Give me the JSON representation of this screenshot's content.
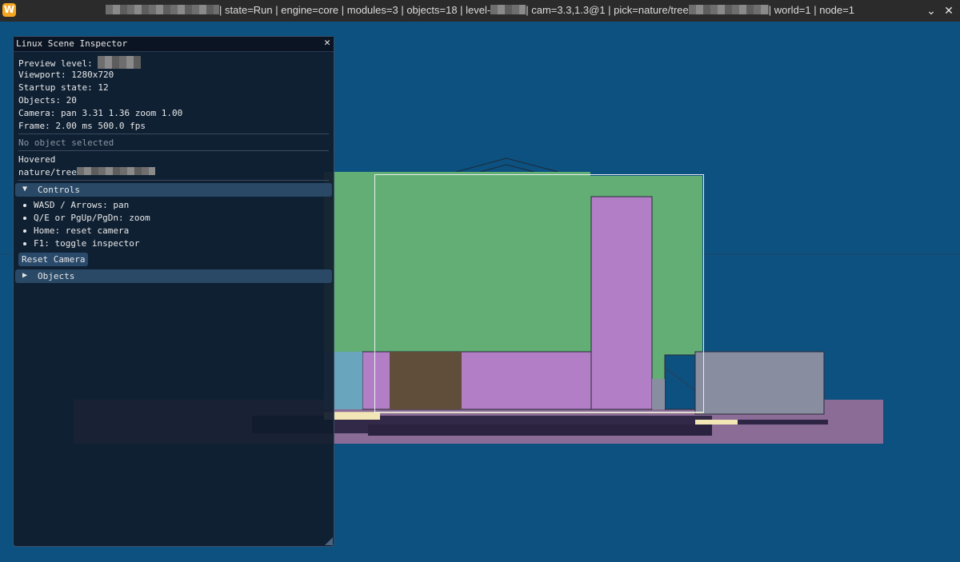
{
  "titlebar": {
    "app_icon": "W",
    "title_segments": [
      "| state=Run | engine=core | modules=3 | objects=18 | level-",
      "| cam=3.3,1.3@1 | pick=nature/tree",
      "| world=1 | node=1"
    ],
    "minimize_glyph": "⌄",
    "close_glyph": "✕"
  },
  "inspector": {
    "title": "Linux Scene Inspector",
    "close_glyph": "✕",
    "preview_level_label": "Preview level:",
    "viewport": "Viewport: 1280x720",
    "startup_state": "Startup state: 12",
    "objects": "Objects: 20",
    "camera": "Camera: pan 3.31 1.36  zoom 1.00",
    "frame": "Frame: 2.00 ms  500.0 fps",
    "selection": "No object selected",
    "hovered_label": "Hovered",
    "hovered_value": "nature/tree",
    "controls_header": "Controls",
    "controls_arrow": "▼",
    "controls": [
      "WASD / Arrows: pan",
      "Q/E or PgUp/PgDn: zoom",
      "Home: reset camera",
      "F1: toggle inspector"
    ],
    "reset_button": "Reset Camera",
    "objects_header": "Objects",
    "objects_arrow": "▶"
  },
  "colors": {
    "background": "#0d5180",
    "titlebar": "#2b2b2b",
    "panel": "#101c2d",
    "header": "#294967",
    "tree_green": "#62ae74",
    "building_purple": "#b27fc6",
    "door_brown": "#604e3a",
    "window_teal": "#69a6be",
    "shed_gray": "#888da0",
    "ground_mauve": "#8a6c96",
    "road_dark": "#322848",
    "highlight_cream": "#f3e6b6"
  }
}
